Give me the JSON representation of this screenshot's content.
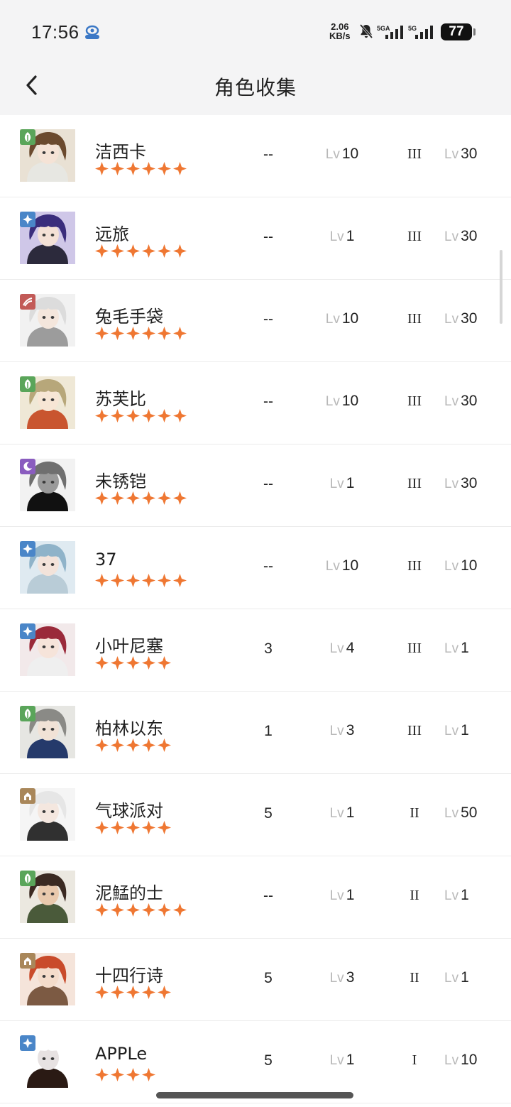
{
  "status_bar": {
    "time": "17:56",
    "speed_value": "2.06",
    "speed_unit": "KB/s",
    "net1": "5GA",
    "net2": "5G",
    "battery": "77"
  },
  "header": {
    "title": "角色收集"
  },
  "colors": {
    "star": "#ef7732",
    "nature": "#5aa55a",
    "spirit": "#4a86c8",
    "beast": "#c25a57",
    "mystery": "#8a5cbf",
    "intellect": "#a9875a"
  },
  "characters": [
    {
      "name": "洁西卡",
      "stars": 6,
      "attr": "nature",
      "a": "--",
      "lv_prefix": "Lv",
      "lv": "10",
      "rank": "III",
      "lv2_prefix": "Lv",
      "lv2": "30"
    },
    {
      "name": "远旅",
      "stars": 6,
      "attr": "spirit",
      "a": "--",
      "lv_prefix": "Lv",
      "lv": "1",
      "rank": "III",
      "lv2_prefix": "Lv",
      "lv2": "30"
    },
    {
      "name": "兔毛手袋",
      "stars": 6,
      "attr": "beast",
      "a": "--",
      "lv_prefix": "Lv",
      "lv": "10",
      "rank": "III",
      "lv2_prefix": "Lv",
      "lv2": "30"
    },
    {
      "name": "苏芙比",
      "stars": 6,
      "attr": "nature",
      "a": "--",
      "lv_prefix": "Lv",
      "lv": "10",
      "rank": "III",
      "lv2_prefix": "Lv",
      "lv2": "30"
    },
    {
      "name": "未锈铠",
      "stars": 6,
      "attr": "mystery",
      "a": "--",
      "lv_prefix": "Lv",
      "lv": "1",
      "rank": "III",
      "lv2_prefix": "Lv",
      "lv2": "30"
    },
    {
      "name": "37",
      "stars": 6,
      "attr": "spirit",
      "a": "--",
      "lv_prefix": "Lv",
      "lv": "10",
      "rank": "III",
      "lv2_prefix": "Lv",
      "lv2": "10"
    },
    {
      "name": "小叶尼塞",
      "stars": 5,
      "attr": "spirit",
      "a": "3",
      "lv_prefix": "Lv",
      "lv": "4",
      "rank": "III",
      "lv2_prefix": "Lv",
      "lv2": "1"
    },
    {
      "name": "柏林以东",
      "stars": 5,
      "attr": "nature",
      "a": "1",
      "lv_prefix": "Lv",
      "lv": "3",
      "rank": "III",
      "lv2_prefix": "Lv",
      "lv2": "1"
    },
    {
      "name": "气球派对",
      "stars": 5,
      "attr": "intellect",
      "a": "5",
      "lv_prefix": "Lv",
      "lv": "1",
      "rank": "II",
      "lv2_prefix": "Lv",
      "lv2": "50"
    },
    {
      "name": "泥鯭的士",
      "stars": 6,
      "attr": "nature",
      "a": "--",
      "lv_prefix": "Lv",
      "lv": "1",
      "rank": "II",
      "lv2_prefix": "Lv",
      "lv2": "1"
    },
    {
      "name": "十四行诗",
      "stars": 5,
      "attr": "intellect",
      "a": "5",
      "lv_prefix": "Lv",
      "lv": "3",
      "rank": "II",
      "lv2_prefix": "Lv",
      "lv2": "1"
    },
    {
      "name": "APPLe",
      "stars": 4,
      "attr": "spirit",
      "a": "5",
      "lv_prefix": "Lv",
      "lv": "1",
      "rank": "I",
      "lv2_prefix": "Lv",
      "lv2": "10"
    }
  ],
  "avatar_palettes": [
    {
      "hair": "#6b4a2e",
      "bg": "#e9e1d4",
      "skin": "#f5e3d6",
      "cloth": "#e7e7e2"
    },
    {
      "hair": "#3a2d7c",
      "bg": "#cfc7e8",
      "skin": "#f4e1d6",
      "cloth": "#2c2a3c"
    },
    {
      "hair": "#dcdcdc",
      "bg": "#f1f1f1",
      "skin": "#f4e6dc",
      "cloth": "#9c9c9c"
    },
    {
      "hair": "#b7a77a",
      "bg": "#efe8d6",
      "skin": "#f7e6d5",
      "cloth": "#c9552f"
    },
    {
      "hair": "#6f6f6f",
      "bg": "#f2f2f2",
      "skin": "#9a9a9a",
      "cloth": "#111111"
    },
    {
      "hair": "#8fb3c9",
      "bg": "#dfeaf1",
      "skin": "#f3e3da",
      "cloth": "#b9ccd7"
    },
    {
      "hair": "#9a2a3a",
      "bg": "#f2e9ea",
      "skin": "#f6e4da",
      "cloth": "#efefef"
    },
    {
      "hair": "#8a8a86",
      "bg": "#e6e6e2",
      "skin": "#f1e2d6",
      "cloth": "#253a6b"
    },
    {
      "hair": "#e6e6e6",
      "bg": "#f5f5f5",
      "skin": "#f4e7df",
      "cloth": "#303030"
    },
    {
      "hair": "#3b2a22",
      "bg": "#ebe8e0",
      "skin": "#e9c9ad",
      "cloth": "#4a5a3a"
    },
    {
      "hair": "#c94b2b",
      "bg": "#f5e4da",
      "skin": "#f4dccb",
      "cloth": "#7c5a43"
    },
    {
      "hair": "#ffffff",
      "bg": "#ffffff",
      "skin": "#e7e2e2",
      "cloth": "#2a1a14"
    }
  ]
}
